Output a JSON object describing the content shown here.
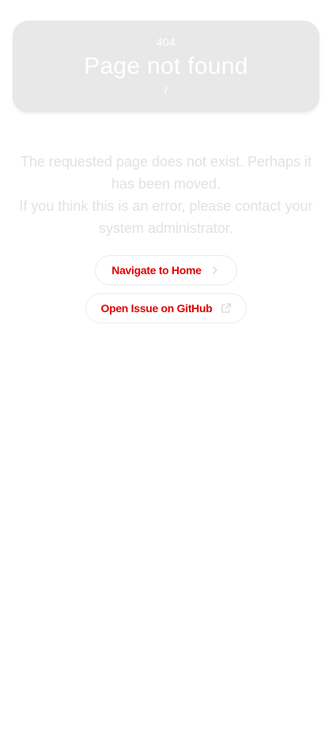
{
  "hero": {
    "code": "404",
    "title": "Page not found",
    "path": "/"
  },
  "message": {
    "line1": "The requested page does not exist. Perhaps it has been moved.",
    "line2": "If you think this is an error, please contact your system administrator."
  },
  "actions": {
    "home_label": "Navigate to Home",
    "issue_label": "Open Issue on GitHub",
    "home_icon": "chevron-right-icon",
    "issue_icon": "external-link-icon"
  },
  "colors": {
    "hero_background": "#e8e8e8",
    "hero_text": "#ffffff",
    "message_text": "#e2e2e2",
    "button_text": "#e00000",
    "button_border": "#ececec"
  }
}
